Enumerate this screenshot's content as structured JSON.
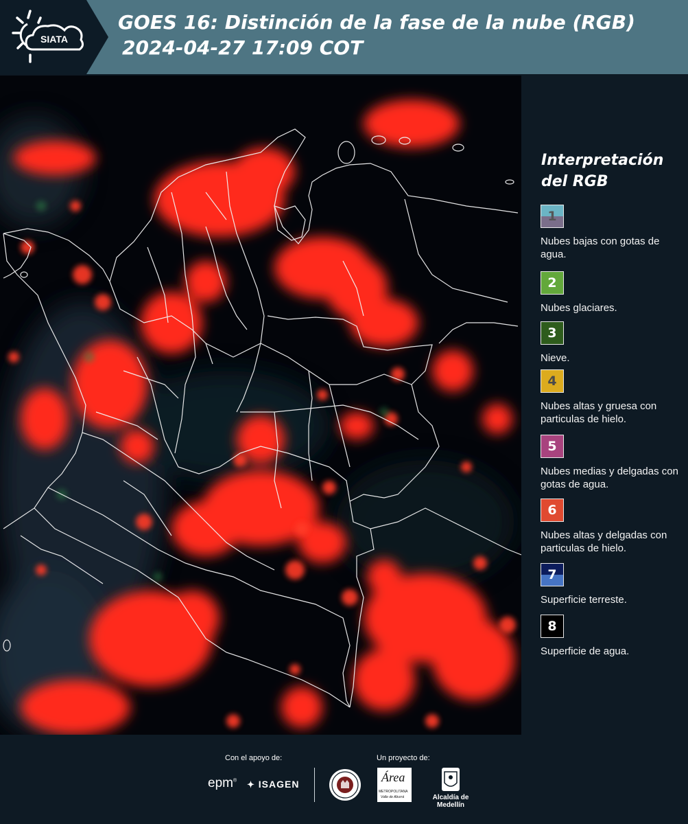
{
  "header": {
    "logo_text": "SIATA",
    "title_line1": "GOES 16: Distinción de la fase de la nube (RGB)",
    "title_line2": "2024-04-27 17:09 COT"
  },
  "legend": {
    "title_line1": "Interpretación",
    "title_line2": "del RGB",
    "items": [
      {
        "num": "1",
        "desc": "Nubes bajas con gotas de agua.",
        "color_top": "#6bb4c4",
        "color_bottom": "#7a6e8a",
        "num_color": "#555555"
      },
      {
        "num": "2",
        "desc": "Nubes glaciares.",
        "color_top": "#63a83b",
        "color_bottom": "#63a83b",
        "num_color": "#ffffff"
      },
      {
        "num": "3",
        "desc": "Nieve.",
        "color_top": "#2e5c1c",
        "color_bottom": "#2e5c1c",
        "num_color": "#ffffff"
      },
      {
        "num": "4",
        "desc": "Nubes altas y gruesa con particulas de hielo.",
        "color_top": "#dcab1e",
        "color_bottom": "#dcab1e",
        "num_color": "#4a4a4a"
      },
      {
        "num": "5",
        "desc": "Nubes medias y delgadas con gotas de agua.",
        "color_top": "#a8437e",
        "color_bottom": "#a8437e",
        "num_color": "#ffffff"
      },
      {
        "num": "6",
        "desc": "Nubes altas y delgadas con particulas de hielo.",
        "color_top": "#e04a30",
        "color_bottom": "#e04a30",
        "num_color": "#ffffff"
      },
      {
        "num": "7",
        "desc": "Superficie terreste.",
        "color_top": "#0c1c5c",
        "color_bottom": "#4674c4",
        "num_color": "#ffffff"
      },
      {
        "num": "8",
        "desc": "Superficie de agua.",
        "color_top": "#000000",
        "color_bottom": "#000000",
        "num_color": "#ffffff"
      }
    ]
  },
  "footer": {
    "support_label": "Con el apoyo de:",
    "project_label": "Un proyecto de:",
    "logo_epm": "epm",
    "logo_isagen": "ISAGEN",
    "logo_area_main": "Área",
    "logo_area_sub1": "METROPOLITANA",
    "logo_area_sub2": "Valle de Aburrá",
    "logo_medellin": "Alcaldía de Medellín"
  }
}
